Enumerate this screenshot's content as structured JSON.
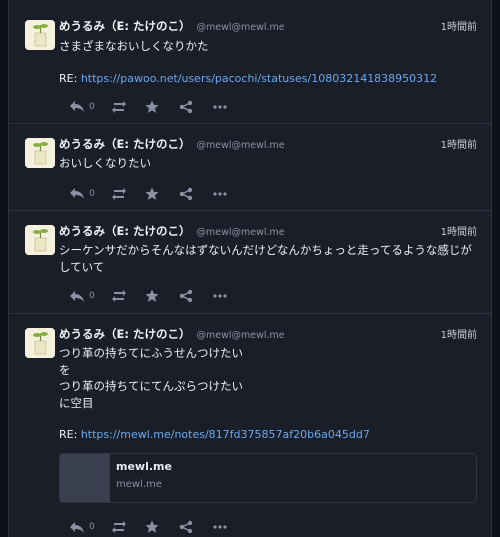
{
  "posts": [
    {
      "display_name": "めうるみ（E: たけのこ）",
      "handle": "@mewl@mewl.me",
      "time": "1時間前",
      "text_lines": [
        "さまざまなおいしくなりかた"
      ],
      "reply_label": "RE:",
      "reply_url": "https://pawoo.net/users/pacochi/statuses/108032141838950312",
      "reply_count": "0"
    },
    {
      "display_name": "めうるみ（E: たけのこ）",
      "handle": "@mewl@mewl.me",
      "time": "1時間前",
      "text_lines": [
        "おいしくなりたい"
      ],
      "reply_count": "0"
    },
    {
      "display_name": "めうるみ（E: たけのこ）",
      "handle": "@mewl@mewl.me",
      "time": "1時間前",
      "text_lines": [
        "シーケンサだからそんなはずないんだけどなんかちょっと走ってるような感じが",
        "していて"
      ],
      "reply_count": "0"
    },
    {
      "display_name": "めうるみ（E: たけのこ）",
      "handle": "@mewl@mewl.me",
      "time": "1時間前",
      "text_lines": [
        "つり革の持ちてにふうせんつけたい",
        "を",
        "つり革の持ちてにてんぷらつけたい",
        "に空目"
      ],
      "reply_label": "RE:",
      "reply_url": "https://mewl.me/notes/817fd375857af20b6a045dd7",
      "card": {
        "title": "mewl.me",
        "host": "mewl.me"
      },
      "reply_count": "0"
    }
  ],
  "icons": {
    "reply": "reply-icon",
    "renote": "renote-icon",
    "reaction": "star-icon",
    "share": "share-icon",
    "more": "more-icon"
  },
  "colors": {
    "background": "#0e1118",
    "panel": "#191e29",
    "link": "#6aa8ee",
    "muted": "#8a91a3"
  }
}
